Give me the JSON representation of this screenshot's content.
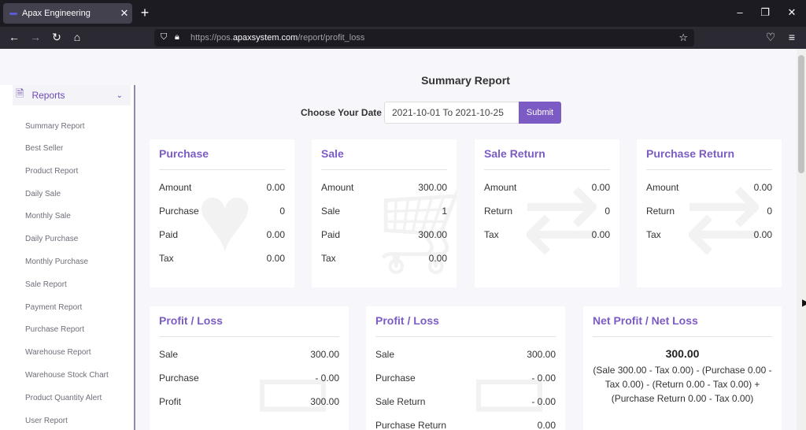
{
  "browser": {
    "tab_title": "Apax Engineering",
    "url_prefix": "https://pos.",
    "url_domain": "apaxsystem.com",
    "url_path": "/report/profit_loss"
  },
  "sidebar": {
    "section_label": "Reports",
    "items": [
      "Summary Report",
      "Best Seller",
      "Product Report",
      "Daily Sale",
      "Monthly Sale",
      "Daily Purchase",
      "Monthly Purchase",
      "Sale Report",
      "Payment Report",
      "Purchase Report",
      "Warehouse Report",
      "Warehouse Stock Chart",
      "Product Quantity Alert",
      "User Report"
    ]
  },
  "report": {
    "title": "Summary Report",
    "date_label": "Choose Your Date",
    "date_value": "2021-10-01 To 2021-10-25",
    "submit_label": "Submit"
  },
  "cards": {
    "purchase": {
      "title": "Purchase",
      "rows": [
        [
          "Amount",
          "0.00"
        ],
        [
          "Purchase",
          "0"
        ],
        [
          "Paid",
          "0.00"
        ],
        [
          "Tax",
          "0.00"
        ]
      ]
    },
    "sale": {
      "title": "Sale",
      "rows": [
        [
          "Amount",
          "300.00"
        ],
        [
          "Sale",
          "1"
        ],
        [
          "Paid",
          "300.00"
        ],
        [
          "Tax",
          "0.00"
        ]
      ]
    },
    "sale_return": {
      "title": "Sale Return",
      "rows": [
        [
          "Amount",
          "0.00"
        ],
        [
          "Return",
          "0"
        ],
        [
          "Tax",
          "0.00"
        ]
      ]
    },
    "purchase_return": {
      "title": "Purchase Return",
      "rows": [
        [
          "Amount",
          "0.00"
        ],
        [
          "Return",
          "0"
        ],
        [
          "Tax",
          "0.00"
        ]
      ]
    },
    "profit_loss_1": {
      "title": "Profit / Loss",
      "rows": [
        [
          "Sale",
          "300.00"
        ],
        [
          "Purchase",
          "- 0.00"
        ],
        [
          "Profit",
          "300.00"
        ]
      ]
    },
    "profit_loss_2": {
      "title": "Profit / Loss",
      "rows": [
        [
          "Sale",
          "300.00"
        ],
        [
          "Purchase",
          "- 0.00"
        ],
        [
          "Sale Return",
          "- 0.00"
        ],
        [
          "Purchase Return",
          "0.00"
        ]
      ]
    },
    "net": {
      "title": "Net Profit / Net Loss",
      "total": "300.00",
      "detail": "(Sale 300.00 - Tax 0.00) - (Purchase 0.00 - Tax 0.00) - (Return 0.00 - Tax 0.00) + (Purchase Return 0.00 - Tax 0.00)"
    }
  }
}
